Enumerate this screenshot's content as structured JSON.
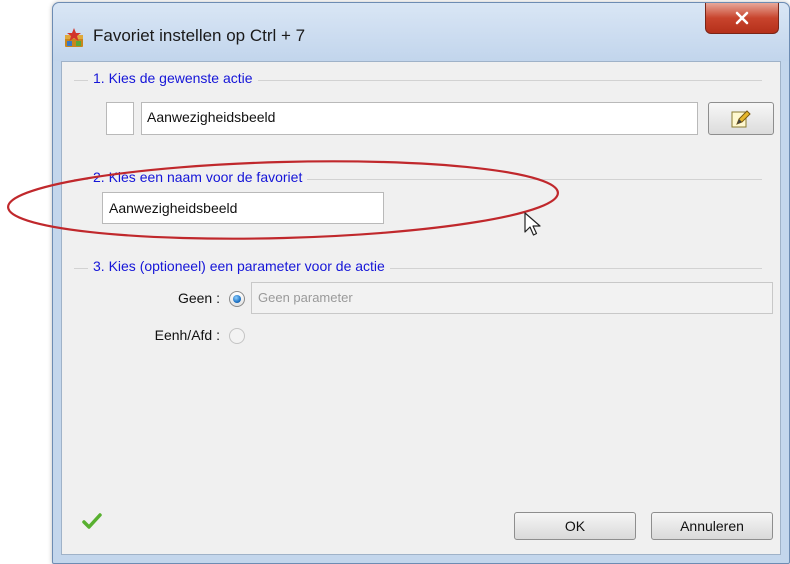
{
  "window": {
    "title": "Favoriet instellen op Ctrl + 7"
  },
  "section1": {
    "title": "1. Kies de gewenste actie",
    "action_value": "Aanwezigheidsbeeld"
  },
  "section2": {
    "title": "2. Kies een naam voor de favoriet",
    "name_value": "Aanwezigheidsbeeld"
  },
  "section3": {
    "title": "3. Kies (optioneel) een parameter voor de actie",
    "options": [
      {
        "label": "Geen :",
        "selected": true,
        "enabled": true
      },
      {
        "label": "Eenh/Afd :",
        "selected": false,
        "enabled": false
      }
    ],
    "param_placeholder": "Geen parameter"
  },
  "footer": {
    "ok_label": "OK",
    "cancel_label": "Annuleren"
  },
  "colors": {
    "group_title": "#1515d8",
    "annotation": "#c0282c",
    "close_button": "#c8442d",
    "status_check": "#58b030"
  },
  "icons": {
    "app": "favorites-app-icon",
    "close": "close-icon",
    "edit": "edit-pencil-icon",
    "status": "checkmark-icon"
  }
}
